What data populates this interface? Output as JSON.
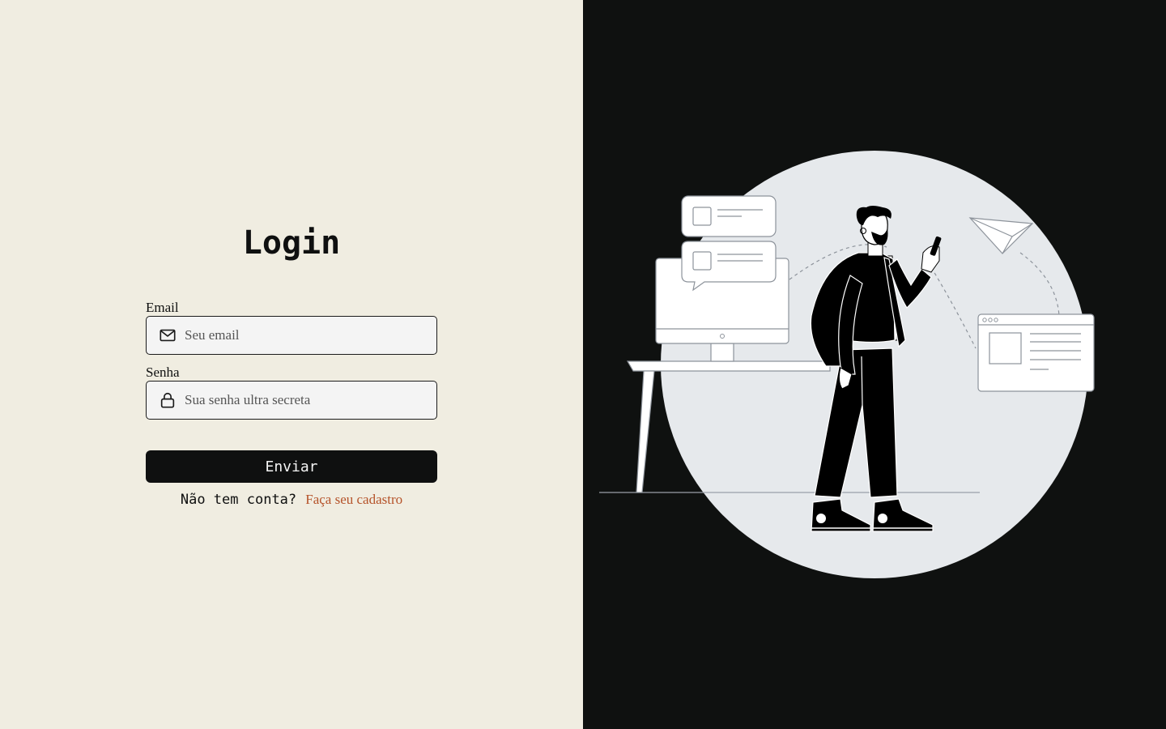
{
  "login": {
    "title": "Login",
    "email": {
      "label": "Email",
      "placeholder": "Seu email",
      "icon": "mail-icon"
    },
    "password": {
      "label": "Senha",
      "placeholder": "Sua senha ultra secreta",
      "icon": "lock-icon"
    },
    "submit_label": "Enviar",
    "signup_prompt": "Não tem conta?",
    "signup_link": "Faça seu cadastro"
  },
  "colors": {
    "left_bg": "#f0ede1",
    "right_bg": "#0f1110",
    "button_bg": "#0f1010",
    "link": "#b5532a",
    "circle": "#e6e9ec"
  }
}
